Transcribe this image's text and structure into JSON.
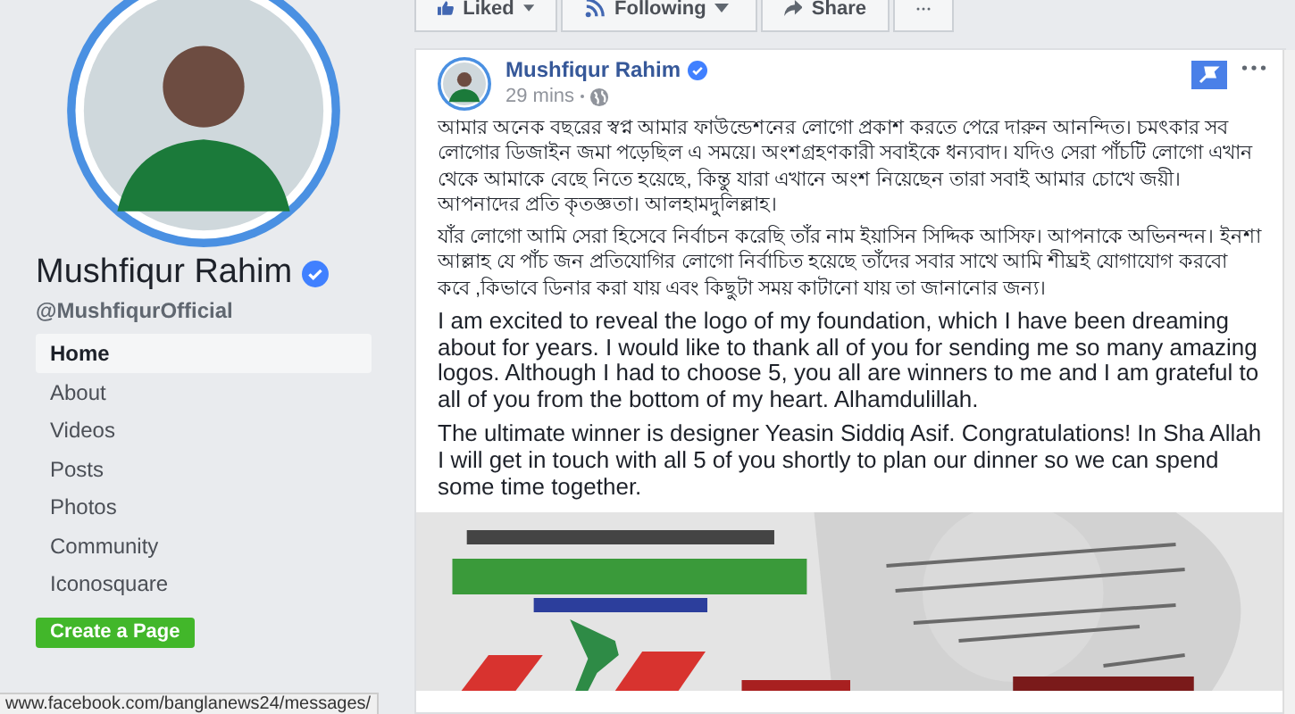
{
  "profile": {
    "name": "Mushfiqur Rahim",
    "verified": true,
    "handle": "@MushfiqurOfficial"
  },
  "nav": [
    {
      "label": "Home",
      "selected": true
    },
    {
      "label": "About",
      "selected": false
    },
    {
      "label": "Videos",
      "selected": false
    },
    {
      "label": "Posts",
      "selected": false
    },
    {
      "label": "Photos",
      "selected": false
    },
    {
      "label": "Community",
      "selected": false
    },
    {
      "label": "Iconosquare",
      "selected": false
    }
  ],
  "create_page_button": "Create a Page",
  "actions": [
    {
      "kind": "like",
      "label": "Liked"
    },
    {
      "kind": "follow",
      "label": "Following"
    },
    {
      "kind": "share",
      "label": "Share"
    },
    {
      "kind": "more"
    }
  ],
  "post": {
    "author": "Mushfiqur Rahim",
    "verified": true,
    "time": "29 mins",
    "pinned": true,
    "paragraphs": [
      "আমার অনেক বছরের স্বপ্ন আমার ফাউন্ডেশনের লোগো প্রকাশ করতে পেরে দারুন আনন্দিত। চমৎকার সব লোগোর ডিজাইন জমা পড়েছিল এ সময়ে। অংশগ্রহণকারী সবাইকে ধন্যবাদ। যদিও সেরা পাঁচটি লোগো এখান থেকে আমাকে বেছে নিতে হয়েছে, কিন্তু যারা এখানে অংশ নিয়েছেন তারা সবাই আমার চোখে জয়ী। আপনাদের প্রতি কৃতজ্ঞতা। আলহামদুলিল্লাহ।",
      "যাঁর লোগো আমি সেরা হিসেবে নির্বাচন করেছি তাঁর নাম ইয়াসিন সিদ্দিক আসিফ। আপনাকে অভিনন্দন। ইনশা আল্লাহ যে পাঁচ জন প্রতিযোগির লোগো নির্বাচিত হয়েছে তাঁদের সবার সাথে আমি শীঘ্রই যোগাযোগ করবো কবে ,কিভাবে ডিনার করা যায় এবং কিছুটা সময় কাটানো যায় তা জানানোর জন্য।",
      "I am excited to reveal the logo of my foundation, which I have been dreaming about for years. I would like to thank all of you for sending me so many amazing logos. Although I had to choose 5, you all are winners to me and I am grateful to all of you from the bottom of my heart. Alhamdulillah.",
      "The ultimate winner is designer Yeasin Siddiq Asif. Congratulations! In Sha Allah I will get in touch with all 5 of you shortly to plan our dinner so we can spend some time together."
    ]
  },
  "status_bar": "www.facebook.com/banglanews24/messages/"
}
